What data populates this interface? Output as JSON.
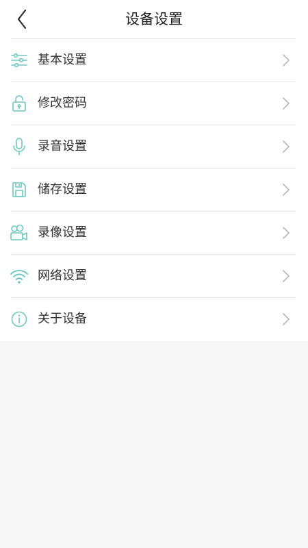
{
  "header": {
    "title": "设备设置",
    "back_icon": "back-chevron-icon"
  },
  "menu": {
    "items": [
      {
        "label": "基本设置",
        "icon": "sliders-icon"
      },
      {
        "label": "修改密码",
        "icon": "unlock-icon"
      },
      {
        "label": "录音设置",
        "icon": "microphone-icon"
      },
      {
        "label": "储存设置",
        "icon": "floppy-disk-icon"
      },
      {
        "label": "录像设置",
        "icon": "video-camera-icon"
      },
      {
        "label": "网络设置",
        "icon": "wifi-icon"
      },
      {
        "label": "关于设备",
        "icon": "info-icon"
      }
    ]
  },
  "colors": {
    "accent": "#6fc7c0",
    "chevron": "#b7b7b7",
    "divider": "#e5e5e5",
    "background": "#f7f7f7"
  }
}
